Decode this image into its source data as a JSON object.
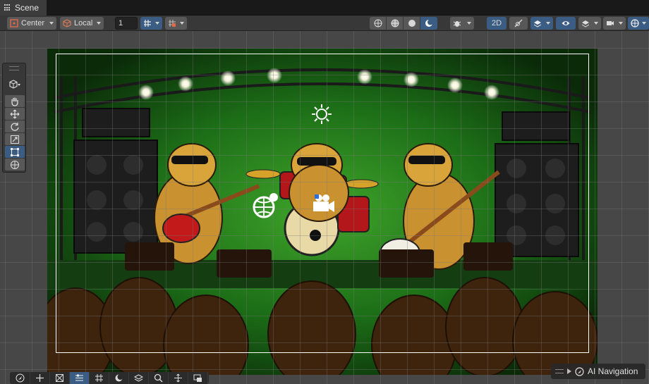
{
  "tab": {
    "label": "Scene"
  },
  "toolbar": {
    "pivot_label": "Center",
    "space_label": "Local",
    "grid_size": "1",
    "mode_2d_label": "2D"
  },
  "overlay": {
    "ai_navigation_label": "AI Navigation"
  },
  "icons": {
    "tab": "grid-icon",
    "pivot": "pivot-center-icon",
    "space": "cube-local-icon",
    "snap": "grid-snap-icon",
    "increment": "increment-snap-icon",
    "shading": [
      "wireframe-icon",
      "shaded-wireframe-icon",
      "shaded-icon",
      "lit-icon"
    ],
    "debug": "bug-icon",
    "lighting": "light-toggle-icon",
    "effects": "effects-icon",
    "visibility": "eye-icon",
    "layers": "layers-icon",
    "camera": "camera-icon",
    "gizmos": "gizmos-icon",
    "tools": [
      "hand-icon",
      "move-icon",
      "rotate-icon",
      "scale-icon",
      "rect-icon",
      "transform-icon"
    ],
    "bottom": [
      "navmesh-icon",
      "move-icon",
      "obstacle-icon",
      "surface-icon",
      "grid-icon",
      "lit-icon",
      "layers-icon",
      "search-icon",
      "move-icon",
      "camera-preview-icon"
    ]
  },
  "colors": {
    "accent_active": "#3b5d84",
    "toolbar_bg": "#383838",
    "viewport_bg": "#474747"
  }
}
